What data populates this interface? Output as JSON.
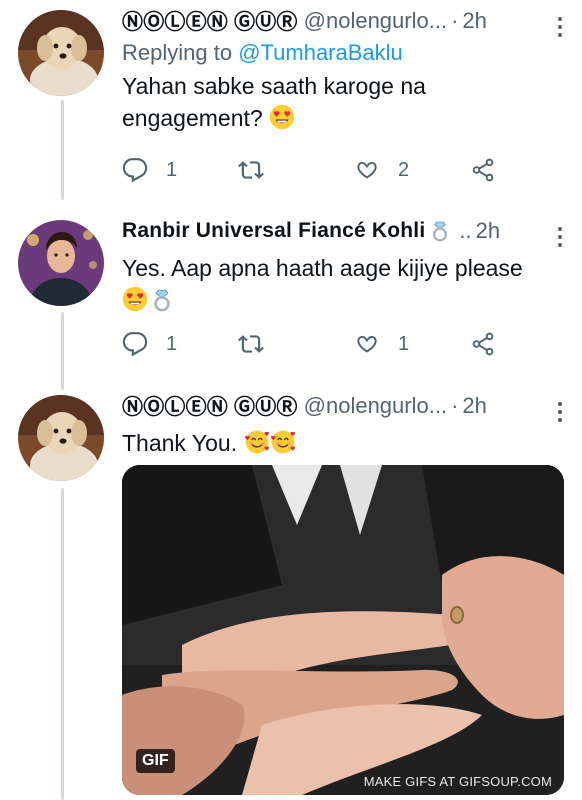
{
  "tweets": [
    {
      "name": "ⓃⓄⓁⒺⓃ ⒼⓊⓇ",
      "handle": "@nolengurlo...",
      "sep": "·",
      "time": "2h",
      "reply_prefix": "Replying to ",
      "reply_handle": "@TumharaBaklu",
      "text": "Yahan sabke saath karoge na engagement?",
      "reply_count": "1",
      "retweet_count": "",
      "like_count": "2",
      "avatar": "dog-avatar"
    },
    {
      "name": "Ranbir Universal Fiancé Kohli",
      "handle": "..",
      "sep": "",
      "time": "2h",
      "text": "Yes. Aap apna haath aage kijiye please",
      "reply_count": "1",
      "retweet_count": "",
      "like_count": "1",
      "avatar": "man-avatar"
    },
    {
      "name": "ⓃⓄⓁⒺⓃ ⒼⓊⓇ",
      "handle": "@nolengurlo...",
      "sep": "·",
      "time": "2h",
      "text": "Thank You.",
      "avatar": "dog-avatar",
      "media": {
        "badge": "GIF",
        "watermark": "MAKE GIFS AT GIFSOUP.COM"
      }
    }
  ],
  "colors": {
    "link": "#1d9bf0",
    "muted": "#536471",
    "thread_line": "#cfd9de"
  },
  "icons": {
    "reply": "reply-icon",
    "retweet": "retweet-icon",
    "like": "heart-icon",
    "share": "share-icon",
    "more": "more-vertical-icon",
    "heart_eyes": "heart-eyes-emoji",
    "ring": "ring-emoji",
    "smiling_hearts": "smiling-face-with-hearts-emoji"
  }
}
